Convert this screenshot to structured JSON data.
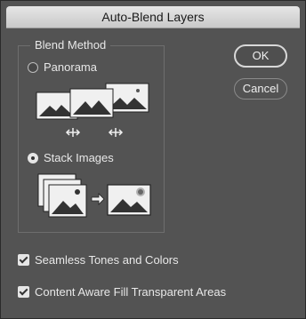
{
  "dialog": {
    "title": "Auto-Blend Layers"
  },
  "blend_method": {
    "group_title": "Blend Method",
    "options": [
      {
        "label": "Panorama",
        "selected": false
      },
      {
        "label": "Stack Images",
        "selected": true
      }
    ]
  },
  "buttons": {
    "ok": "OK",
    "cancel": "Cancel"
  },
  "checkboxes": [
    {
      "label": "Seamless Tones and Colors",
      "checked": true
    },
    {
      "label": "Content Aware Fill Transparent Areas",
      "checked": true
    }
  ],
  "icons": {
    "panorama_preview": "panorama-preview-icon",
    "stack_preview": "stack-images-preview-icon"
  }
}
